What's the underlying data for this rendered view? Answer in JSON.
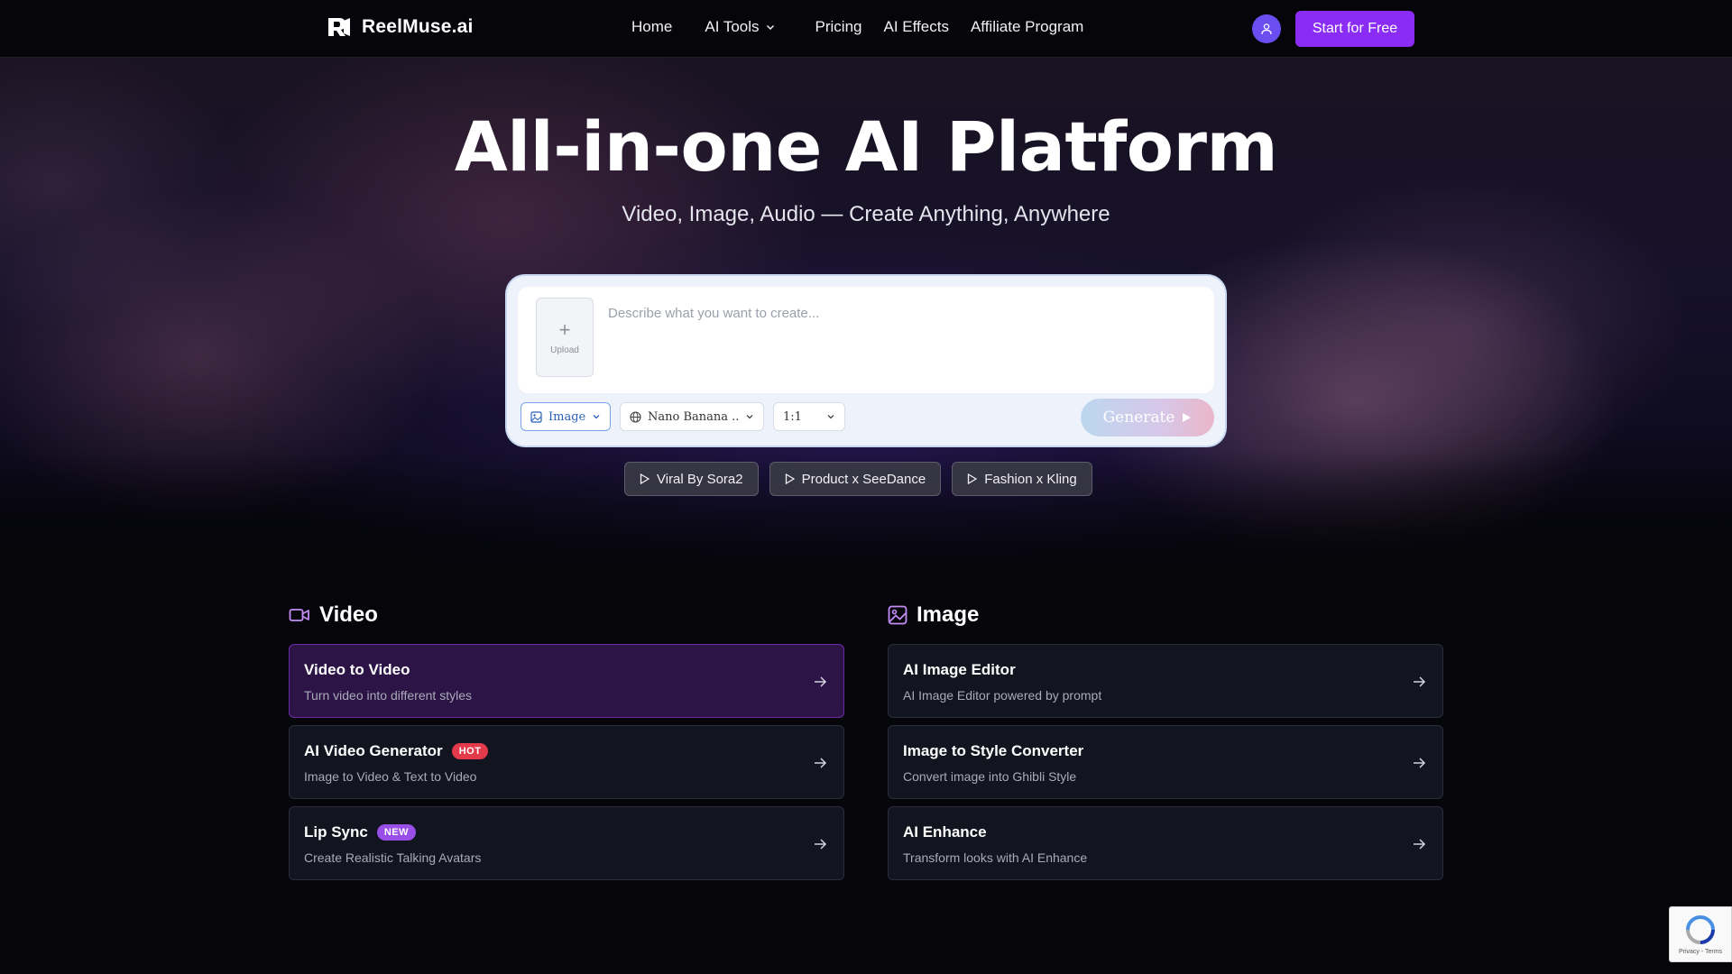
{
  "nav": {
    "logo_text": "ReelMuse.ai",
    "home": "Home",
    "ai_tools": "AI Tools",
    "pricing": "Pricing",
    "ai_effects": "AI Effects",
    "affiliate": "Affiliate Program",
    "cta": "Start for Free"
  },
  "hero": {
    "title": "All-in-one AI Platform",
    "subtitle": "Video, Image, Audio — Create Anything, Anywhere"
  },
  "prompt": {
    "upload_label": "Upload",
    "placeholder": "Describe what you want to create...",
    "type_select": "Image",
    "model_select": "Nano Banana ...",
    "ratio_select": "1:1",
    "generate": "Generate"
  },
  "chips": [
    "Viral By Sora2",
    "Product x SeeDance",
    "Fashion x Kling"
  ],
  "video": {
    "heading": "Video",
    "cards": [
      {
        "title": "Video to Video",
        "desc": "Turn video into different styles",
        "badge": ""
      },
      {
        "title": "AI Video Generator",
        "desc": "Image to Video & Text to Video",
        "badge": "HOT"
      },
      {
        "title": "Lip Sync",
        "desc": "Create Realistic Talking Avatars",
        "badge": "NEW"
      }
    ]
  },
  "image": {
    "heading": "Image",
    "cards": [
      {
        "title": "AI Image Editor",
        "desc": "AI Image Editor powered by prompt"
      },
      {
        "title": "Image to Style Converter",
        "desc": "Convert image into Ghibli Style"
      },
      {
        "title": "AI Enhance",
        "desc": "Transform looks with AI Enhance"
      }
    ]
  },
  "recaptcha": {
    "footer": "Privacy - Terms"
  },
  "colors": {
    "accent": "#8b2cf5",
    "avatar": "#6b4ef0",
    "hot_badge": "#e23a4a",
    "new_badge": "#9a4ee8",
    "section_icon": "#c58cf5",
    "active_card": "#2d1446"
  }
}
